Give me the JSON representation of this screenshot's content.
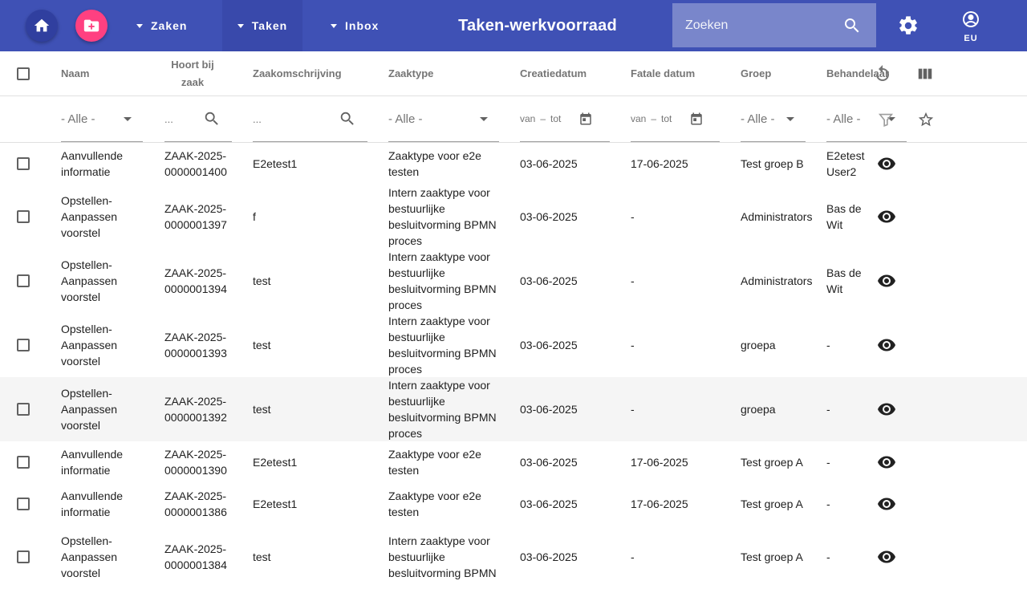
{
  "header": {
    "nav": {
      "zaken": "Zaken",
      "taken": "Taken",
      "inbox": "Inbox"
    },
    "title": "Taken-werkvoorraad",
    "search_placeholder": "Zoeken",
    "user_initials": "EU",
    "colors": {
      "primary": "#3f51b5",
      "accent": "#ff4081",
      "active_tab": "#3949ab"
    }
  },
  "table": {
    "columns": {
      "naam": "Naam",
      "zaak": "Hoort bij zaak",
      "omschrijving": "Zaakomschrijving",
      "zaaktype": "Zaaktype",
      "creatiedatum": "Creatiedatum",
      "fataledatum": "Fatale datum",
      "groep": "Groep",
      "behandelaar": "Behandelaar"
    },
    "filters": {
      "all": "- Alle -",
      "text_placeholder": "...",
      "van": "van",
      "tot": "tot",
      "dash": "–"
    },
    "rows": [
      {
        "naam": [
          "Aanvullende",
          "informatie"
        ],
        "zaak": [
          "ZAAK-2025-",
          "0000001400"
        ],
        "omschrijving": "E2etest1",
        "zaaktype": [
          "Zaaktype voor e2e",
          "testen"
        ],
        "creatie": "03-06-2025",
        "fatale": "17-06-2025",
        "groep": "Test groep B",
        "behandelaar": "E2etest User2"
      },
      {
        "naam": [
          "Opstellen-",
          "Aanpassen",
          "voorstel"
        ],
        "zaak": [
          "ZAAK-2025-",
          "0000001397"
        ],
        "omschrijving": "f",
        "zaaktype": [
          "Intern zaaktype voor",
          "bestuurlijke",
          "besluitvorming BPMN",
          "proces"
        ],
        "creatie": "03-06-2025",
        "fatale": "-",
        "groep": "Administrators",
        "behandelaar": "Bas de Wit"
      },
      {
        "naam": [
          "Opstellen-",
          "Aanpassen",
          "voorstel"
        ],
        "zaak": [
          "ZAAK-2025-",
          "0000001394"
        ],
        "omschrijving": "test",
        "zaaktype": [
          "Intern zaaktype voor",
          "bestuurlijke",
          "besluitvorming BPMN",
          "proces"
        ],
        "creatie": "03-06-2025",
        "fatale": "-",
        "groep": "Administrators",
        "behandelaar": "Bas de Wit"
      },
      {
        "naam": [
          "Opstellen-",
          "Aanpassen",
          "voorstel"
        ],
        "zaak": [
          "ZAAK-2025-",
          "0000001393"
        ],
        "omschrijving": "test",
        "zaaktype": [
          "Intern zaaktype voor",
          "bestuurlijke",
          "besluitvorming BPMN",
          "proces"
        ],
        "creatie": "03-06-2025",
        "fatale": "-",
        "groep": "groepa",
        "behandelaar": "-"
      },
      {
        "naam": [
          "Opstellen-",
          "Aanpassen",
          "voorstel"
        ],
        "zaak": [
          "ZAAK-2025-",
          "0000001392"
        ],
        "omschrijving": "test",
        "zaaktype": [
          "Intern zaaktype voor",
          "bestuurlijke",
          "besluitvorming BPMN",
          "proces"
        ],
        "creatie": "03-06-2025",
        "fatale": "-",
        "groep": "groepa",
        "behandelaar": "-"
      },
      {
        "naam": [
          "Aanvullende",
          "informatie"
        ],
        "zaak": [
          "ZAAK-2025-",
          "0000001390"
        ],
        "omschrijving": "E2etest1",
        "zaaktype": [
          "Zaaktype voor e2e",
          "testen"
        ],
        "creatie": "03-06-2025",
        "fatale": "17-06-2025",
        "groep": "Test groep A",
        "behandelaar": "-"
      },
      {
        "naam": [
          "Aanvullende",
          "informatie"
        ],
        "zaak": [
          "ZAAK-2025-",
          "0000001386"
        ],
        "omschrijving": "E2etest1",
        "zaaktype": [
          "Zaaktype voor e2e",
          "testen"
        ],
        "creatie": "03-06-2025",
        "fatale": "17-06-2025",
        "groep": "Test groep A",
        "behandelaar": "-"
      },
      {
        "naam": [
          "Opstellen-",
          "Aanpassen",
          "voorstel"
        ],
        "zaak": [
          "ZAAK-2025-",
          "0000001384"
        ],
        "omschrijving": "test",
        "zaaktype": [
          "Intern zaaktype voor",
          "bestuurlijke",
          "besluitvorming BPMN"
        ],
        "creatie": "03-06-2025",
        "fatale": "-",
        "groep": "Test groep A",
        "behandelaar": "-"
      }
    ]
  }
}
